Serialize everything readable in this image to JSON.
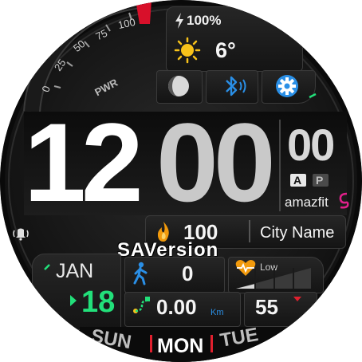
{
  "battery": {
    "icon": "lightning-icon",
    "value": "100%"
  },
  "weather": {
    "icon": "sun-icon",
    "temperature": "6°"
  },
  "quick_buttons": [
    {
      "name": "moon-phase",
      "icon": "moon-icon"
    },
    {
      "name": "bluetooth",
      "icon": "bluetooth-icon"
    },
    {
      "name": "settings",
      "icon": "gear-icon"
    }
  ],
  "power_dial": {
    "ticks": [
      "0",
      "25",
      "50",
      "75",
      "100"
    ],
    "label": "PWR",
    "level_percent": 100
  },
  "time": {
    "hours": "12",
    "minutes": "00",
    "seconds": "00",
    "am": "A",
    "pm": "P",
    "brand": "amazfit"
  },
  "alarm": {
    "icon": "alarm-bell-icon"
  },
  "calories": {
    "icon": "flame-icon",
    "value": "100"
  },
  "city": {
    "name": "City Name"
  },
  "watermark": "SAVersion",
  "date": {
    "month": "JAN",
    "day": "18"
  },
  "steps": {
    "icon": "walking-person-icon",
    "value": "0"
  },
  "heart": {
    "icon": "heart-rate-icon",
    "zone_label": "Low"
  },
  "distance": {
    "icon": "route-icon",
    "value": "0.00",
    "unit": "Km"
  },
  "heart_rate": {
    "value": "55"
  },
  "weekdays": [
    "SUN",
    "MON",
    "TUE"
  ],
  "colors": {
    "accent_green": "#22e07a",
    "accent_red": "#e0202e",
    "accent_blue": "#2a8fe6",
    "sun_yellow": "#f7c21a",
    "flame_orange": "#f29a0c"
  }
}
